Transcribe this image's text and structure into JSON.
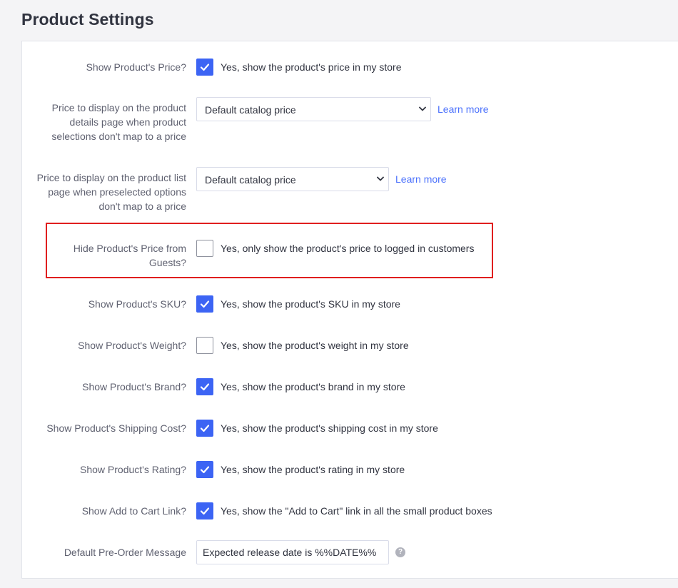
{
  "page": {
    "title": "Product Settings"
  },
  "settings": {
    "show_price": {
      "label": "Show Product's Price?",
      "checked": true,
      "option_text": "Yes, show the product's price in my store"
    },
    "details_price": {
      "label": "Price to display on the product details page when product selections don't map to a price",
      "selected": "Default catalog price",
      "learn_more": "Learn more"
    },
    "list_price": {
      "label": "Price to display on the product list page when preselected options don't map to a price",
      "selected": "Default catalog price",
      "learn_more": "Learn more"
    },
    "hide_price": {
      "label": "Hide Product's Price from Guests?",
      "checked": false,
      "option_text": "Yes, only show the product's price to logged in customers"
    },
    "show_sku": {
      "label": "Show Product's SKU?",
      "checked": true,
      "option_text": "Yes, show the product's SKU in my store"
    },
    "show_weight": {
      "label": "Show Product's Weight?",
      "checked": false,
      "option_text": "Yes, show the product's weight in my store"
    },
    "show_brand": {
      "label": "Show Product's Brand?",
      "checked": true,
      "option_text": "Yes, show the product's brand in my store"
    },
    "show_shipping": {
      "label": "Show Product's Shipping Cost?",
      "checked": true,
      "option_text": "Yes, show the product's shipping cost in my store"
    },
    "show_rating": {
      "label": "Show Product's Rating?",
      "checked": true,
      "option_text": "Yes, show the product's rating in my store"
    },
    "show_add_to_cart": {
      "label": "Show Add to Cart Link?",
      "checked": true,
      "option_text": "Yes, show the \"Add to Cart\" link in all the small product boxes"
    },
    "preorder_message": {
      "label": "Default Pre-Order Message",
      "value": "Expected release date is %%DATE%%",
      "help_icon": "question-mark-icon",
      "help_glyph": "?"
    }
  },
  "colors": {
    "accent": "#3c64f4",
    "link": "#4b71fc",
    "highlight": "#e01e1e",
    "background": "#f4f4f6"
  }
}
